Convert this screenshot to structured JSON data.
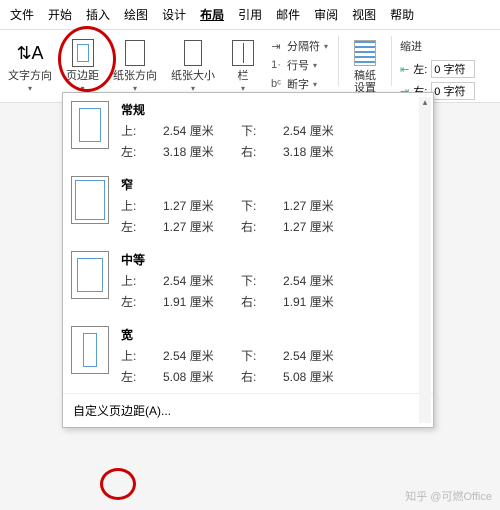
{
  "menu": [
    "文件",
    "开始",
    "插入",
    "绘图",
    "设计",
    "布局",
    "引用",
    "邮件",
    "审阅",
    "视图",
    "帮助"
  ],
  "menu_active_index": 5,
  "ribbon": {
    "textdir": "文字方向",
    "margins": "页边距",
    "orient": "纸张方向",
    "size": "纸张大小",
    "columns": "栏",
    "breaks": "分隔符",
    "linenum": "行号",
    "hyphen": "断字",
    "draft": "稿纸\n设置",
    "indent_title": "缩进",
    "indent_left_label": "左:",
    "indent_right_label": "右:",
    "indent_left_value": "0 字符",
    "indent_right_value": "0 字符"
  },
  "labels": {
    "top": "上:",
    "bottom": "下:",
    "left": "左:",
    "right": "右:"
  },
  "presets": [
    {
      "name": "常规",
      "class": "normal",
      "top": "2.54 厘米",
      "bottom": "2.54 厘米",
      "left": "3.18 厘米",
      "right": "3.18 厘米"
    },
    {
      "name": "窄",
      "class": "narrow",
      "top": "1.27 厘米",
      "bottom": "1.27 厘米",
      "left": "1.27 厘米",
      "right": "1.27 厘米"
    },
    {
      "name": "中等",
      "class": "medium",
      "top": "2.54 厘米",
      "bottom": "2.54 厘米",
      "left": "1.91 厘米",
      "right": "1.91 厘米"
    },
    {
      "name": "宽",
      "class": "wide",
      "top": "2.54 厘米",
      "bottom": "2.54 厘米",
      "left": "5.08 厘米",
      "right": "5.08 厘米"
    }
  ],
  "custom_label": "自定义页边距(A)...",
  "watermark": "知乎 @可燃Office"
}
